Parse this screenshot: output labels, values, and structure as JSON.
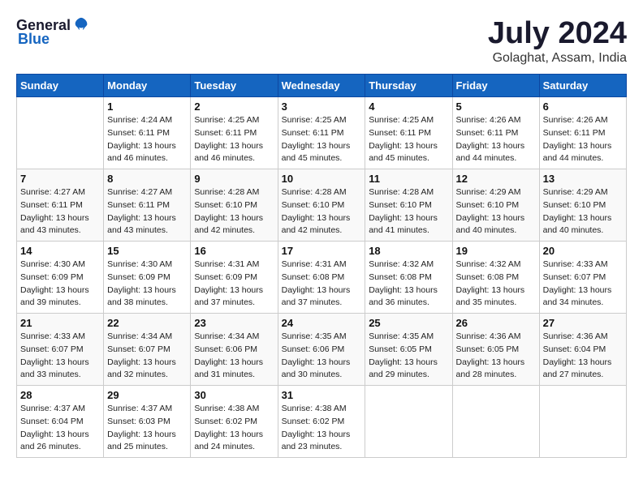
{
  "header": {
    "logo_general": "General",
    "logo_blue": "Blue",
    "title": "July 2024",
    "subtitle": "Golaghat, Assam, India"
  },
  "columns": [
    "Sunday",
    "Monday",
    "Tuesday",
    "Wednesday",
    "Thursday",
    "Friday",
    "Saturday"
  ],
  "weeks": [
    [
      {
        "day": "",
        "sunrise": "",
        "sunset": "",
        "daylight": ""
      },
      {
        "day": "1",
        "sunrise": "Sunrise: 4:24 AM",
        "sunset": "Sunset: 6:11 PM",
        "daylight": "Daylight: 13 hours and 46 minutes."
      },
      {
        "day": "2",
        "sunrise": "Sunrise: 4:25 AM",
        "sunset": "Sunset: 6:11 PM",
        "daylight": "Daylight: 13 hours and 46 minutes."
      },
      {
        "day": "3",
        "sunrise": "Sunrise: 4:25 AM",
        "sunset": "Sunset: 6:11 PM",
        "daylight": "Daylight: 13 hours and 45 minutes."
      },
      {
        "day": "4",
        "sunrise": "Sunrise: 4:25 AM",
        "sunset": "Sunset: 6:11 PM",
        "daylight": "Daylight: 13 hours and 45 minutes."
      },
      {
        "day": "5",
        "sunrise": "Sunrise: 4:26 AM",
        "sunset": "Sunset: 6:11 PM",
        "daylight": "Daylight: 13 hours and 44 minutes."
      },
      {
        "day": "6",
        "sunrise": "Sunrise: 4:26 AM",
        "sunset": "Sunset: 6:11 PM",
        "daylight": "Daylight: 13 hours and 44 minutes."
      }
    ],
    [
      {
        "day": "7",
        "sunrise": "Sunrise: 4:27 AM",
        "sunset": "Sunset: 6:11 PM",
        "daylight": "Daylight: 13 hours and 43 minutes."
      },
      {
        "day": "8",
        "sunrise": "Sunrise: 4:27 AM",
        "sunset": "Sunset: 6:11 PM",
        "daylight": "Daylight: 13 hours and 43 minutes."
      },
      {
        "day": "9",
        "sunrise": "Sunrise: 4:28 AM",
        "sunset": "Sunset: 6:10 PM",
        "daylight": "Daylight: 13 hours and 42 minutes."
      },
      {
        "day": "10",
        "sunrise": "Sunrise: 4:28 AM",
        "sunset": "Sunset: 6:10 PM",
        "daylight": "Daylight: 13 hours and 42 minutes."
      },
      {
        "day": "11",
        "sunrise": "Sunrise: 4:28 AM",
        "sunset": "Sunset: 6:10 PM",
        "daylight": "Daylight: 13 hours and 41 minutes."
      },
      {
        "day": "12",
        "sunrise": "Sunrise: 4:29 AM",
        "sunset": "Sunset: 6:10 PM",
        "daylight": "Daylight: 13 hours and 40 minutes."
      },
      {
        "day": "13",
        "sunrise": "Sunrise: 4:29 AM",
        "sunset": "Sunset: 6:10 PM",
        "daylight": "Daylight: 13 hours and 40 minutes."
      }
    ],
    [
      {
        "day": "14",
        "sunrise": "Sunrise: 4:30 AM",
        "sunset": "Sunset: 6:09 PM",
        "daylight": "Daylight: 13 hours and 39 minutes."
      },
      {
        "day": "15",
        "sunrise": "Sunrise: 4:30 AM",
        "sunset": "Sunset: 6:09 PM",
        "daylight": "Daylight: 13 hours and 38 minutes."
      },
      {
        "day": "16",
        "sunrise": "Sunrise: 4:31 AM",
        "sunset": "Sunset: 6:09 PM",
        "daylight": "Daylight: 13 hours and 37 minutes."
      },
      {
        "day": "17",
        "sunrise": "Sunrise: 4:31 AM",
        "sunset": "Sunset: 6:08 PM",
        "daylight": "Daylight: 13 hours and 37 minutes."
      },
      {
        "day": "18",
        "sunrise": "Sunrise: 4:32 AM",
        "sunset": "Sunset: 6:08 PM",
        "daylight": "Daylight: 13 hours and 36 minutes."
      },
      {
        "day": "19",
        "sunrise": "Sunrise: 4:32 AM",
        "sunset": "Sunset: 6:08 PM",
        "daylight": "Daylight: 13 hours and 35 minutes."
      },
      {
        "day": "20",
        "sunrise": "Sunrise: 4:33 AM",
        "sunset": "Sunset: 6:07 PM",
        "daylight": "Daylight: 13 hours and 34 minutes."
      }
    ],
    [
      {
        "day": "21",
        "sunrise": "Sunrise: 4:33 AM",
        "sunset": "Sunset: 6:07 PM",
        "daylight": "Daylight: 13 hours and 33 minutes."
      },
      {
        "day": "22",
        "sunrise": "Sunrise: 4:34 AM",
        "sunset": "Sunset: 6:07 PM",
        "daylight": "Daylight: 13 hours and 32 minutes."
      },
      {
        "day": "23",
        "sunrise": "Sunrise: 4:34 AM",
        "sunset": "Sunset: 6:06 PM",
        "daylight": "Daylight: 13 hours and 31 minutes."
      },
      {
        "day": "24",
        "sunrise": "Sunrise: 4:35 AM",
        "sunset": "Sunset: 6:06 PM",
        "daylight": "Daylight: 13 hours and 30 minutes."
      },
      {
        "day": "25",
        "sunrise": "Sunrise: 4:35 AM",
        "sunset": "Sunset: 6:05 PM",
        "daylight": "Daylight: 13 hours and 29 minutes."
      },
      {
        "day": "26",
        "sunrise": "Sunrise: 4:36 AM",
        "sunset": "Sunset: 6:05 PM",
        "daylight": "Daylight: 13 hours and 28 minutes."
      },
      {
        "day": "27",
        "sunrise": "Sunrise: 4:36 AM",
        "sunset": "Sunset: 6:04 PM",
        "daylight": "Daylight: 13 hours and 27 minutes."
      }
    ],
    [
      {
        "day": "28",
        "sunrise": "Sunrise: 4:37 AM",
        "sunset": "Sunset: 6:04 PM",
        "daylight": "Daylight: 13 hours and 26 minutes."
      },
      {
        "day": "29",
        "sunrise": "Sunrise: 4:37 AM",
        "sunset": "Sunset: 6:03 PM",
        "daylight": "Daylight: 13 hours and 25 minutes."
      },
      {
        "day": "30",
        "sunrise": "Sunrise: 4:38 AM",
        "sunset": "Sunset: 6:02 PM",
        "daylight": "Daylight: 13 hours and 24 minutes."
      },
      {
        "day": "31",
        "sunrise": "Sunrise: 4:38 AM",
        "sunset": "Sunset: 6:02 PM",
        "daylight": "Daylight: 13 hours and 23 minutes."
      },
      {
        "day": "",
        "sunrise": "",
        "sunset": "",
        "daylight": ""
      },
      {
        "day": "",
        "sunrise": "",
        "sunset": "",
        "daylight": ""
      },
      {
        "day": "",
        "sunrise": "",
        "sunset": "",
        "daylight": ""
      }
    ]
  ]
}
